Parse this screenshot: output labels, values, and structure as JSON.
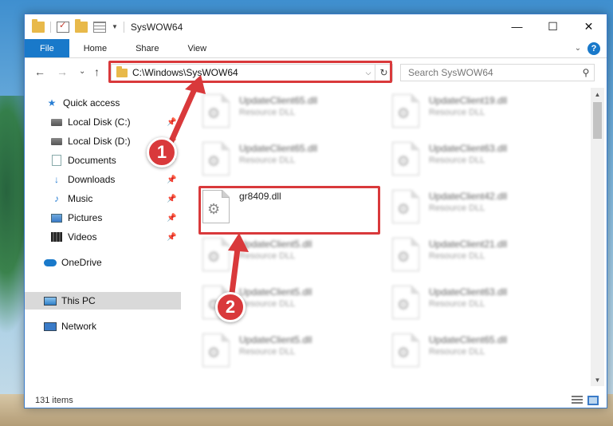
{
  "window": {
    "title": "SysWOW64",
    "controls": {
      "minimize": "—",
      "maximize": "☐",
      "close": "✕"
    }
  },
  "ribbon": {
    "tabs": [
      "File",
      "Home",
      "Share",
      "View"
    ],
    "help": "?"
  },
  "nav": {
    "back": "←",
    "forward": "→",
    "recent": "⌄",
    "up": "↑",
    "address": "C:\\Windows\\SysWOW64",
    "search_placeholder": "Search SysWOW64"
  },
  "sidebar": {
    "items": [
      {
        "label": "Quick access",
        "icon": "quick-access-star-icon"
      },
      {
        "label": "Local Disk (C:)",
        "icon": "drive-icon",
        "pinned": true
      },
      {
        "label": "Local Disk (D:)",
        "icon": "drive-icon",
        "pinned": true
      },
      {
        "label": "Documents",
        "icon": "documents-icon",
        "pinned": true
      },
      {
        "label": "Downloads",
        "icon": "downloads-icon",
        "pinned": true
      },
      {
        "label": "Music",
        "icon": "music-icon",
        "pinned": true
      },
      {
        "label": "Pictures",
        "icon": "pictures-icon",
        "pinned": true
      },
      {
        "label": "Videos",
        "icon": "videos-icon",
        "pinned": true
      },
      {
        "label": "OneDrive",
        "icon": "onedrive-icon"
      },
      {
        "label": "This PC",
        "icon": "this-pc-icon",
        "selected": true
      },
      {
        "label": "Network",
        "icon": "network-icon"
      }
    ]
  },
  "files": [
    {
      "name": "UpdateClient65.dll",
      "type": "Resource DLL",
      "blurred": true
    },
    {
      "name": "UpdateClient19.dll",
      "type": "Resource DLL",
      "blurred": true
    },
    {
      "name": "UpdateClient65.dll",
      "type": "Resource DLL",
      "blurred": true
    },
    {
      "name": "UpdateClient63.dll",
      "type": "Resource DLL",
      "blurred": true
    },
    {
      "name": "gr8409.dll",
      "type": "",
      "blurred": false
    },
    {
      "name": "UpdateClient42.dll",
      "type": "Resource DLL",
      "blurred": true
    },
    {
      "name": "UpdateClient5.dll",
      "type": "Resource DLL",
      "blurred": true
    },
    {
      "name": "UpdateClient21.dll",
      "type": "Resource DLL",
      "blurred": true
    },
    {
      "name": "UpdateClient5.dll",
      "type": "Resource DLL",
      "blurred": true
    },
    {
      "name": "UpdateClient63.dll",
      "type": "Resource DLL",
      "blurred": true
    },
    {
      "name": "UpdateClient5.dll",
      "type": "Resource DLL",
      "blurred": true
    },
    {
      "name": "UpdateClient65.dll",
      "type": "Resource DLL",
      "blurred": true
    }
  ],
  "status": {
    "item_count": "131 items"
  },
  "annotations": {
    "step1": "1",
    "step2": "2",
    "color": "#d9393b"
  }
}
